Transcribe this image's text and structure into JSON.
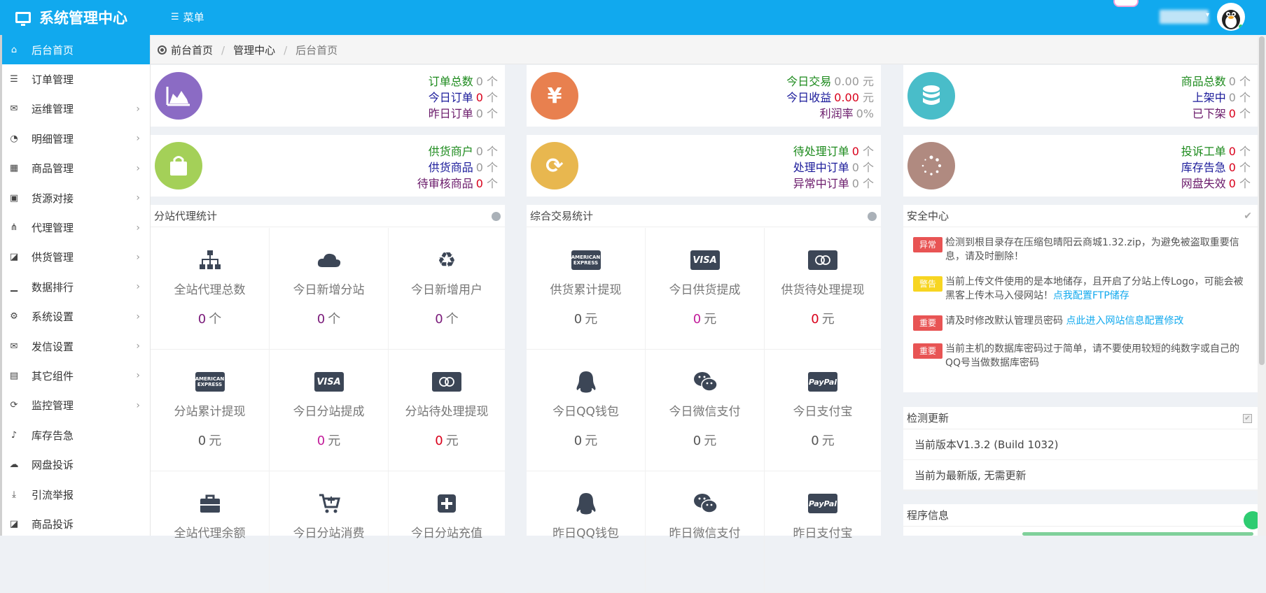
{
  "header": {
    "brand": "系统管理中心",
    "menu_label": "菜单"
  },
  "sidebar": {
    "items": [
      {
        "label": "后台首页",
        "icon": "home-icon",
        "glyph": "⌂",
        "active": true,
        "arrow": false
      },
      {
        "label": "订单管理",
        "icon": "list-icon",
        "glyph": "☰",
        "active": false,
        "arrow": false
      },
      {
        "label": "运维管理",
        "icon": "comments-icon",
        "glyph": "✉",
        "active": false,
        "arrow": true
      },
      {
        "label": "明细管理",
        "icon": "pie-chart-icon",
        "glyph": "◔",
        "active": false,
        "arrow": true
      },
      {
        "label": "商品管理",
        "icon": "grid-icon",
        "glyph": "▦",
        "active": false,
        "arrow": true
      },
      {
        "label": "货源对接",
        "icon": "briefcase-icon",
        "glyph": "▣",
        "active": false,
        "arrow": true
      },
      {
        "label": "代理管理",
        "icon": "sitemap-icon",
        "glyph": "⋔",
        "active": false,
        "arrow": true
      },
      {
        "label": "供货管理",
        "icon": "shopping-bag-icon",
        "glyph": "◪",
        "active": false,
        "arrow": true
      },
      {
        "label": "数据排行",
        "icon": "signal-icon",
        "glyph": "▁",
        "active": false,
        "arrow": true
      },
      {
        "label": "系统设置",
        "icon": "gears-icon",
        "glyph": "⚙",
        "active": false,
        "arrow": true
      },
      {
        "label": "发信设置",
        "icon": "envelope-open-icon",
        "glyph": "✉",
        "active": false,
        "arrow": true
      },
      {
        "label": "其它组件",
        "icon": "calendar-icon",
        "glyph": "▤",
        "active": false,
        "arrow": true
      },
      {
        "label": "监控管理",
        "icon": "refresh-icon",
        "glyph": "⟳",
        "active": false,
        "arrow": true
      },
      {
        "label": "库存告急",
        "icon": "bell-icon",
        "glyph": "♪",
        "active": false,
        "arrow": false
      },
      {
        "label": "网盘投诉",
        "icon": "cloud-download-icon",
        "glyph": "☁",
        "active": false,
        "arrow": false
      },
      {
        "label": "引流举报",
        "icon": "download-icon",
        "glyph": "⤓",
        "active": false,
        "arrow": false
      },
      {
        "label": "商品投诉",
        "icon": "shopping-bag-icon",
        "glyph": "◪",
        "active": false,
        "arrow": false
      }
    ]
  },
  "breadcrumb": {
    "home": "前台首页",
    "mid": "管理中心",
    "current": "后台首页",
    "sep": "/"
  },
  "stats": {
    "orders": {
      "icon": "area-chart-icon",
      "color": "#8b6bc4",
      "rows": [
        {
          "label": "订单总数",
          "value": "0",
          "unit": "个"
        },
        {
          "label": "今日订单",
          "value": "0",
          "unit": "个"
        },
        {
          "label": "昨日订单",
          "value": "0",
          "unit": "个"
        }
      ]
    },
    "trade": {
      "icon": "yen-icon",
      "color": "#e8804f",
      "rows": [
        {
          "label": "今日交易",
          "value": "0.00",
          "unit": "元"
        },
        {
          "label": "今日收益",
          "value": "0.00",
          "unit": "元"
        },
        {
          "label": "利润率",
          "value": "0%",
          "unit": ""
        }
      ]
    },
    "goods": {
      "icon": "database-icon",
      "color": "#49bdc9",
      "rows": [
        {
          "label": "商品总数",
          "value": "0",
          "unit": "个"
        },
        {
          "label": "上架中",
          "value": "0",
          "unit": "个"
        },
        {
          "label": "已下架",
          "value": "0",
          "unit": "个"
        }
      ]
    },
    "supply": {
      "icon": "shopping-bag-icon",
      "color": "#a4d058",
      "rows": [
        {
          "label": "供货商户",
          "value": "0",
          "unit": "个"
        },
        {
          "label": "供货商品",
          "value": "0",
          "unit": "个"
        },
        {
          "label": "待审核商品",
          "value": "0",
          "unit": "个"
        }
      ]
    },
    "pending": {
      "icon": "refresh-icon",
      "color": "#e8b74f",
      "rows": [
        {
          "label": "待处理订单",
          "value": "0",
          "unit": "个"
        },
        {
          "label": "处理中订单",
          "value": "0",
          "unit": "个"
        },
        {
          "label": "异常中订单",
          "value": "0",
          "unit": "个"
        }
      ]
    },
    "complaints": {
      "icon": "spinner-icon",
      "color": "#b08a80",
      "rows": [
        {
          "label": "投诉工单",
          "value": "0",
          "unit": "个"
        },
        {
          "label": "库存告急",
          "value": "0",
          "unit": "个"
        },
        {
          "label": "网盘失效",
          "value": "0",
          "unit": "个"
        }
      ]
    }
  },
  "branch_panel": {
    "title": "分站代理统计",
    "cells": [
      {
        "label": "全站代理总数",
        "value": "0",
        "unit": "个",
        "icon": "sitemap-icon"
      },
      {
        "label": "今日新增分站",
        "value": "0",
        "unit": "个",
        "icon": "cloud-icon"
      },
      {
        "label": "今日新增用户",
        "value": "0",
        "unit": "个",
        "icon": "recycle-icon"
      },
      {
        "label": "分站累计提现",
        "value": "0",
        "unit": "元",
        "icon": "amex-icon"
      },
      {
        "label": "今日分站提成",
        "value": "0",
        "unit": "元",
        "icon": "visa-icon"
      },
      {
        "label": "分站待处理提现",
        "value": "0",
        "unit": "元",
        "icon": "mastercard-icon"
      },
      {
        "label": "全站代理余额",
        "value": "",
        "unit": "",
        "icon": "briefcase-icon"
      },
      {
        "label": "今日分站消费",
        "value": "",
        "unit": "",
        "icon": "cart-icon"
      },
      {
        "label": "今日分站充值",
        "value": "",
        "unit": "",
        "icon": "plus-square-icon"
      }
    ]
  },
  "trade_panel": {
    "title": "综合交易统计",
    "cells": [
      {
        "label": "供货累计提现",
        "value": "0",
        "unit": "元",
        "icon": "amex-icon"
      },
      {
        "label": "今日供货提成",
        "value": "0",
        "unit": "元",
        "icon": "visa-icon"
      },
      {
        "label": "供货待处理提现",
        "value": "0",
        "unit": "元",
        "icon": "mastercard-icon"
      },
      {
        "label": "今日QQ钱包",
        "value": "0",
        "unit": "元",
        "icon": "qq-icon"
      },
      {
        "label": "今日微信支付",
        "value": "0",
        "unit": "元",
        "icon": "wechat-icon"
      },
      {
        "label": "今日支付宝",
        "value": "0",
        "unit": "元",
        "icon": "paypal-icon"
      },
      {
        "label": "昨日QQ钱包",
        "value": "",
        "unit": "",
        "icon": "qq-icon"
      },
      {
        "label": "昨日微信支付",
        "value": "",
        "unit": "",
        "icon": "wechat-icon"
      },
      {
        "label": "昨日支付宝",
        "value": "",
        "unit": "",
        "icon": "paypal-icon"
      }
    ]
  },
  "security": {
    "title": "安全中心",
    "items": [
      {
        "tag": "异常",
        "tag_color": "red",
        "text": "检测到根目录存在压缩包晴阳云商城1.32.zip，为避免被盗取重要信息，请及时删除！",
        "link": ""
      },
      {
        "tag": "警告",
        "tag_color": "yellow",
        "text": "当前上传文件使用的是本地储存，且开启了分站上传Logo，可能会被黑客上传木马入侵网站！",
        "link": "点我配置FTP储存"
      },
      {
        "tag": "重要",
        "tag_color": "red",
        "text": "请及时修改默认管理员密码 ",
        "link": "点此进入网站信息配置修改"
      },
      {
        "tag": "重要",
        "tag_color": "red",
        "text": "当前主机的数据库密码过于简单，请不要使用较短的纯数字或自己的QQ号当做数据库密码",
        "link": ""
      }
    ]
  },
  "updates": {
    "title": "检测更新",
    "version": "当前版本V1.3.2 (Build 1032)",
    "status": "当前为最新版, 无需更新"
  },
  "program": {
    "title": "程序信息"
  },
  "colors": {
    "primary": "#11a9ee",
    "red": "#d9001b",
    "green": "#1c8a1c",
    "navy": "#1a1a9a",
    "purple": "#6a1a6a",
    "magenta": "#c21c9a"
  }
}
